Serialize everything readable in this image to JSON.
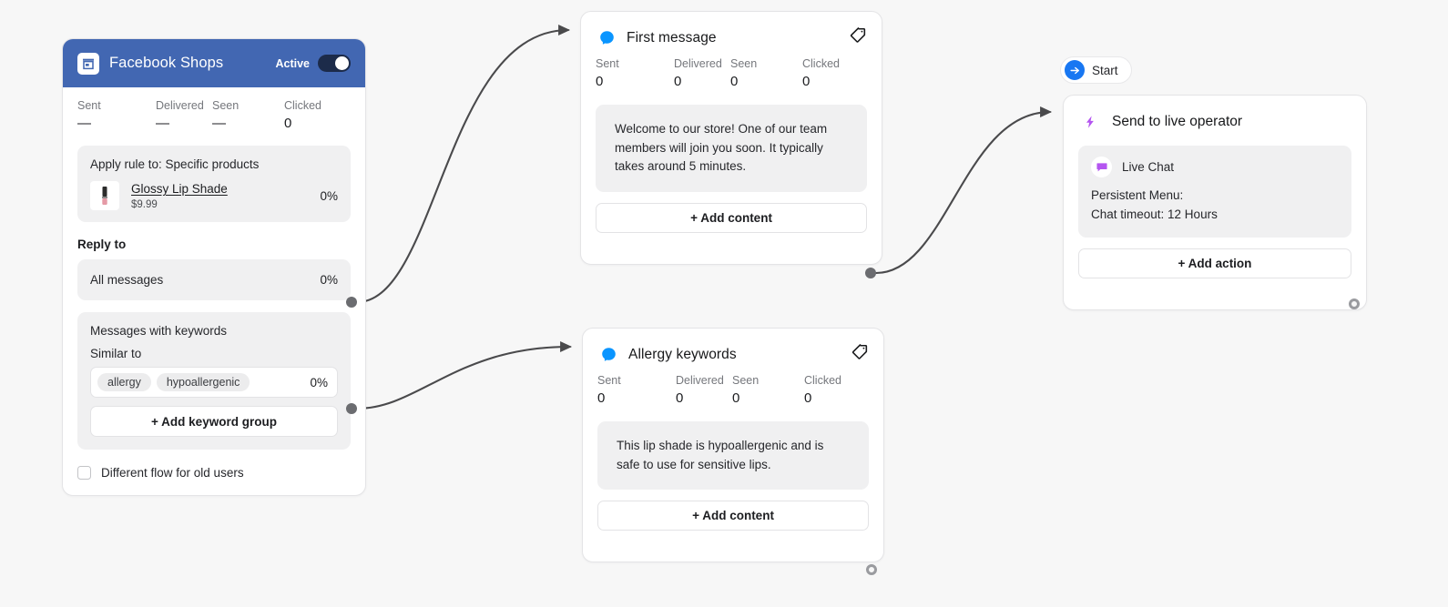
{
  "canvas": {
    "background": "#f7f7f7",
    "edge_color": "#4a4a4c"
  },
  "shops_node": {
    "icon": "facebook-shops-storefront-icon",
    "title": "Facebook Shops",
    "status_label": "Active",
    "toggle_state": "on",
    "accent": "#4267b2",
    "stats": [
      {
        "key": "Sent",
        "value": "—"
      },
      {
        "key": "Delivered",
        "value": "—"
      },
      {
        "key": "Seen",
        "value": "—"
      },
      {
        "key": "Clicked",
        "value": "0"
      }
    ],
    "rule": {
      "title": "Apply rule to: Specific products",
      "product": {
        "thumb_icon": "lipstick-product-thumbnail",
        "name": "Glossy Lip Shade",
        "price": "$9.99",
        "percent": "0%"
      }
    },
    "reply_to_label": "Reply to",
    "all_messages": {
      "label": "All messages",
      "percent": "0%"
    },
    "keyword_group": {
      "heading": "Messages with keywords",
      "sub_label": "Similar to",
      "chips": [
        "allergy",
        "hypoallergenic"
      ],
      "percent": "0%",
      "add_label": "+  Add keyword group"
    },
    "old_users": {
      "label": "Different flow for old users",
      "checked": false
    }
  },
  "message_nodes": [
    {
      "badge_icon": "messenger-bubble-icon",
      "title": "First message",
      "tag_icon": "tag-icon",
      "stats": [
        {
          "key": "Sent",
          "value": "0"
        },
        {
          "key": "Delivered",
          "value": "0"
        },
        {
          "key": "Seen",
          "value": "0"
        },
        {
          "key": "Clicked",
          "value": "0"
        }
      ],
      "bubble_text": "Welcome to our store! One of our team members will join you soon. It typically takes around 5 minutes.",
      "add_label": "+  Add content"
    },
    {
      "badge_icon": "messenger-bubble-icon",
      "title": "Allergy keywords",
      "tag_icon": "tag-icon",
      "stats": [
        {
          "key": "Sent",
          "value": "0"
        },
        {
          "key": "Delivered",
          "value": "0"
        },
        {
          "key": "Seen",
          "value": "0"
        },
        {
          "key": "Clicked",
          "value": "0"
        }
      ],
      "bubble_text": "This lip shade is hypoallergenic and is safe to use for sensitive lips.",
      "add_label": "+  Add content"
    }
  ],
  "start_badge": {
    "icon": "arrow-right-circle-icon",
    "label": "Start"
  },
  "operator_node": {
    "badge_icon": "lightning-bolt-icon",
    "title": "Send to live operator",
    "accent": "#b455f0",
    "channel": {
      "icon": "live-chat-icon",
      "label": "Live Chat"
    },
    "lines": [
      "Persistent Menu:",
      "Chat timeout: 12 Hours"
    ],
    "add_label": "+  Add action"
  }
}
